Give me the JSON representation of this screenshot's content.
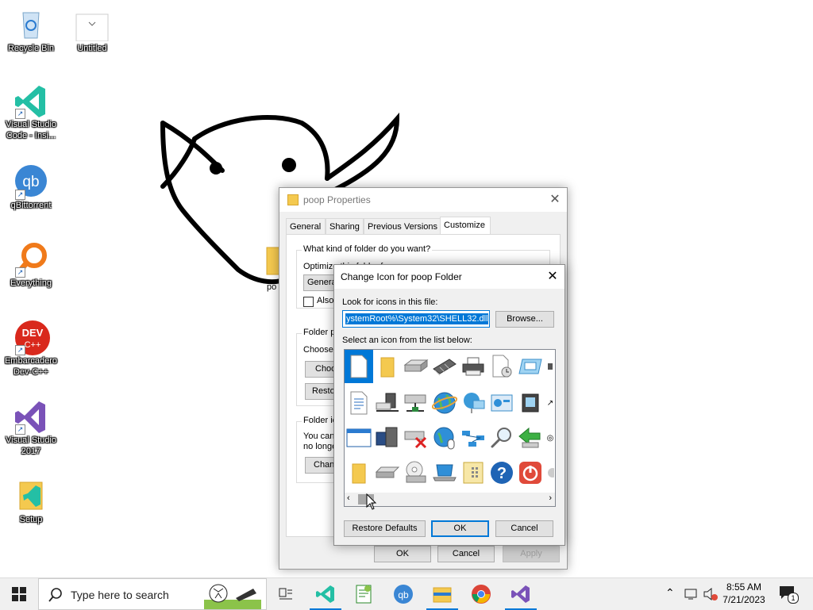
{
  "desktop": {
    "icons": [
      {
        "label": "Recycle Bin"
      },
      {
        "label": "Untitled"
      },
      {
        "label": "Visual Studio Code - Insi..."
      },
      {
        "label": "qBittorrent"
      },
      {
        "label": "Everything"
      },
      {
        "label": "Embarcadero Dev-C++"
      },
      {
        "label": "Visual Studio 2017"
      },
      {
        "label": "Setup"
      }
    ],
    "folder_label_partial": "po"
  },
  "properties_window": {
    "title": "poop Properties",
    "tabs": [
      "General",
      "Sharing",
      "Previous Versions",
      "Customize"
    ],
    "active_tab": "Customize",
    "customize": {
      "group1_title": "What kind of folder do you want?",
      "optimize_label": "Optimize this folder for:",
      "optimize_value": "Genera",
      "also_apply_label": "Also",
      "group2_title": "Folder p",
      "choose_label": "Choose",
      "choose_button": "Choo",
      "restore_button": "Resto",
      "group3_title": "Folder ic",
      "icon_text_1": "You can",
      "icon_text_2": "no longe",
      "change_button": "Chan"
    },
    "buttons": {
      "ok": "OK",
      "cancel": "Cancel",
      "apply": "Apply"
    }
  },
  "change_icon_dialog": {
    "title": "Change Icon for poop Folder",
    "look_label": "Look for icons in this file:",
    "file_path": "ystemRoot%\\System32\\SHELL32.dll",
    "browse_button": "Browse...",
    "select_label": "Select an icon from the list below:",
    "icons": [
      [
        "blank-document-icon",
        "folder-icon",
        "drive-icon",
        "memory-chip-icon",
        "printer-icon",
        "document-clock-icon",
        "monitor-window-icon",
        "partial-icon"
      ],
      [
        "text-document-icon",
        "computer-network-icon",
        "network-drive-icon",
        "globe-icon",
        "network-computers-icon",
        "control-panel-icon",
        "audio-settings-icon",
        "shortcut-overlay-icon"
      ],
      [
        "window-icon",
        "floppy-icon",
        "drive-delete-icon",
        "globe-mouse-icon",
        "network-icon",
        "search-icon",
        "arrow-back-icon",
        "overlay-icon"
      ],
      [
        "folder-small-icon",
        "drive-flat-icon",
        "cd-drive-icon",
        "laptop-icon",
        "keypad-icon",
        "help-icon",
        "power-icon",
        "partial-icon"
      ]
    ],
    "buttons": {
      "restore_defaults": "Restore Defaults",
      "ok": "OK",
      "cancel": "Cancel"
    }
  },
  "taskbar": {
    "search_placeholder": "Type here to search",
    "time": "8:55 AM",
    "date": "7/21/2023",
    "notification_count": "1",
    "apps": [
      "task-view",
      "vscode",
      "notepad-plus",
      "qbittorrent",
      "file-explorer",
      "chrome",
      "visual-studio"
    ]
  }
}
